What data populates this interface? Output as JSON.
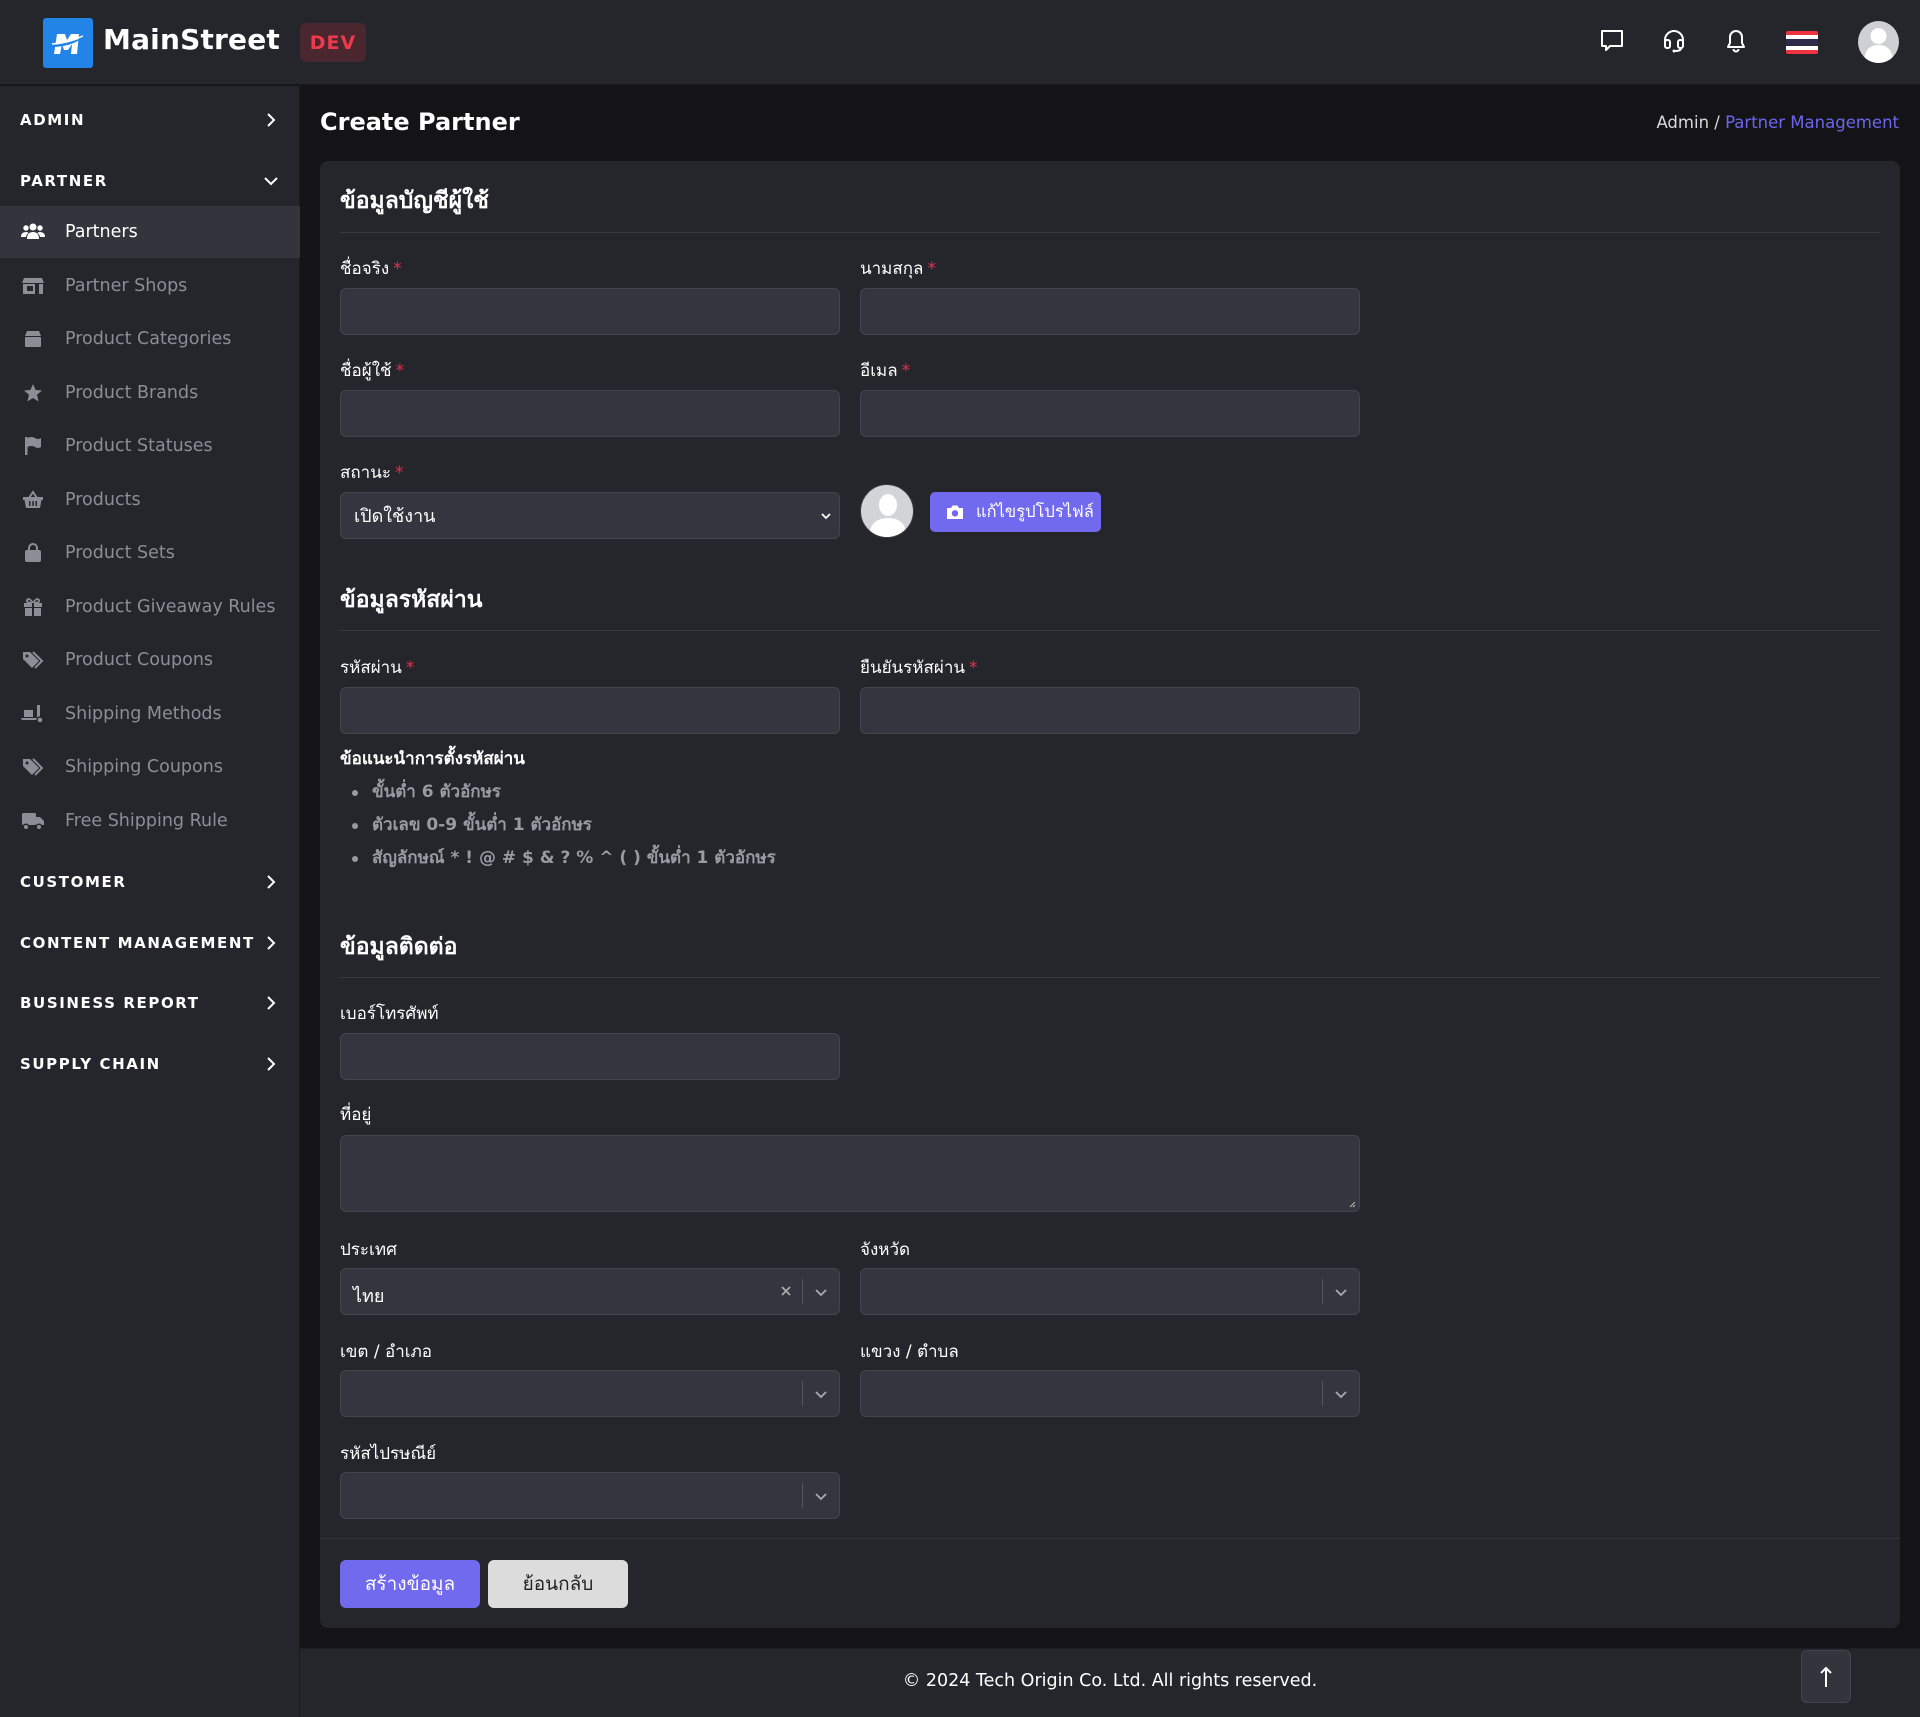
{
  "app": {
    "brand": "MainStreet",
    "env_badge": "DEV",
    "brand_color": "#2384e8",
    "accent_color": "#7169ee"
  },
  "topbar": {
    "icons": [
      "chat-icon",
      "headset-icon",
      "bell-icon",
      "thai-flag-icon",
      "user-avatar"
    ]
  },
  "sidebar": {
    "sections": [
      {
        "label": "ADMIN",
        "expanded": false
      },
      {
        "label": "PARTNER",
        "expanded": true
      },
      {
        "label": "CUSTOMER",
        "expanded": false
      },
      {
        "label": "CONTENT MANAGEMENT",
        "expanded": false
      },
      {
        "label": "BUSINESS REPORT",
        "expanded": false
      },
      {
        "label": "SUPPLY CHAIN",
        "expanded": false
      }
    ],
    "partner_items": [
      {
        "label": "Partners",
        "icon": "users-icon",
        "active": true
      },
      {
        "label": "Partner Shops",
        "icon": "store-icon",
        "active": false
      },
      {
        "label": "Product Categories",
        "icon": "box-icon",
        "active": false
      },
      {
        "label": "Product Brands",
        "icon": "star-icon",
        "active": false
      },
      {
        "label": "Product Statuses",
        "icon": "flag-icon",
        "active": false
      },
      {
        "label": "Products",
        "icon": "basket-icon",
        "active": false
      },
      {
        "label": "Product Sets",
        "icon": "bag-icon",
        "active": false
      },
      {
        "label": "Product Giveaway Rules",
        "icon": "gift-icon",
        "active": false
      },
      {
        "label": "Product Coupons",
        "icon": "tags-icon",
        "active": false
      },
      {
        "label": "Shipping Methods",
        "icon": "dolly-icon",
        "active": false
      },
      {
        "label": "Shipping Coupons",
        "icon": "tags-icon",
        "active": false
      },
      {
        "label": "Free Shipping Rule",
        "icon": "truck-icon",
        "active": false
      }
    ]
  },
  "page": {
    "title": "Create Partner",
    "breadcrumb": {
      "root": "Admin",
      "separator": "/",
      "current": "Partner Management"
    }
  },
  "form": {
    "account_section": {
      "title": "ข้อมูลบัญชีผู้ใช้",
      "first_name": {
        "label": "ชื่อจริง",
        "required": "*",
        "value": ""
      },
      "last_name": {
        "label": "นามสกุล",
        "required": "*",
        "value": ""
      },
      "username": {
        "label": "ชื่อผู้ใช้",
        "required": "*",
        "value": ""
      },
      "email": {
        "label": "อีเมล",
        "required": "*",
        "value": ""
      },
      "status": {
        "label": "สถานะ",
        "required": "*",
        "value": "เปิดใช้งาน"
      },
      "edit_photo_button": "แก้ไขรูปโปรไฟล์"
    },
    "password_section": {
      "title": "ข้อมูลรหัสผ่าน",
      "password": {
        "label": "รหัสผ่าน",
        "required": "*",
        "value": ""
      },
      "confirm_password": {
        "label": "ยืนยันรหัสผ่าน",
        "required": "*",
        "value": ""
      },
      "hint_title": "ข้อแนะนำการตั้งรหัสผ่าน",
      "hints": [
        "ขั้นต่ำ 6 ตัวอักษร",
        "ตัวเลข 0-9 ขั้นต่ำ 1 ตัวอักษร",
        "สัญลักษณ์ * ! @ # $ & ? % ^ ( ) ขั้นต่ำ 1 ตัวอักษร"
      ]
    },
    "contact_section": {
      "title": "ข้อมูลติดต่อ",
      "phone": {
        "label": "เบอร์โทรศัพท์",
        "value": ""
      },
      "address": {
        "label": "ที่อยู่",
        "value": ""
      },
      "country": {
        "label": "ประเทศ",
        "value": "ไทย"
      },
      "province": {
        "label": "จังหวัด",
        "value": ""
      },
      "district": {
        "label": "เขต / อำเภอ",
        "value": ""
      },
      "subdistrict": {
        "label": "แขวง / ตำบล",
        "value": ""
      },
      "postcode": {
        "label": "รหัสไปรษณีย์",
        "value": ""
      }
    },
    "buttons": {
      "submit": "สร้างข้อมูล",
      "back": "ย้อนกลับ"
    }
  },
  "footer": {
    "copyright": "© 2024 Tech Origin Co. Ltd. All rights reserved."
  }
}
